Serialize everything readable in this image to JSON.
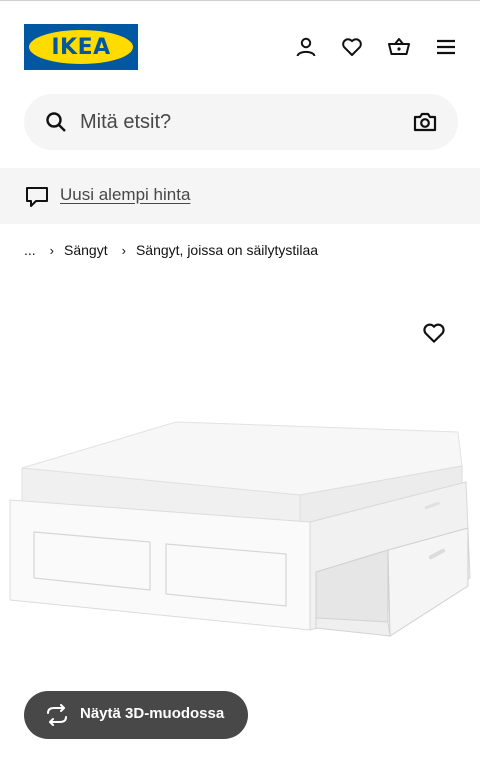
{
  "header": {
    "logo_text": "IKEA",
    "icons": [
      "account-icon",
      "heart-icon",
      "shopping-bag-icon",
      "menu-icon"
    ]
  },
  "search": {
    "placeholder": "Mitä etsit?"
  },
  "banner": {
    "icon": "speech-bubble-icon",
    "link_text": "Uusi alempi hinta"
  },
  "breadcrumb": {
    "ellipsis": "...",
    "items": [
      "Sängyt",
      "Sängyt, joissa on säilytystilaa"
    ]
  },
  "product": {
    "favourite_icon": "heart-icon",
    "view_3d_label": "Näytä 3D-muodossa"
  },
  "colors": {
    "ikea_blue": "#0058a3",
    "ikea_yellow": "#ffdb00",
    "surface_gray": "#f5f5f5",
    "button_dark": "#484848"
  }
}
